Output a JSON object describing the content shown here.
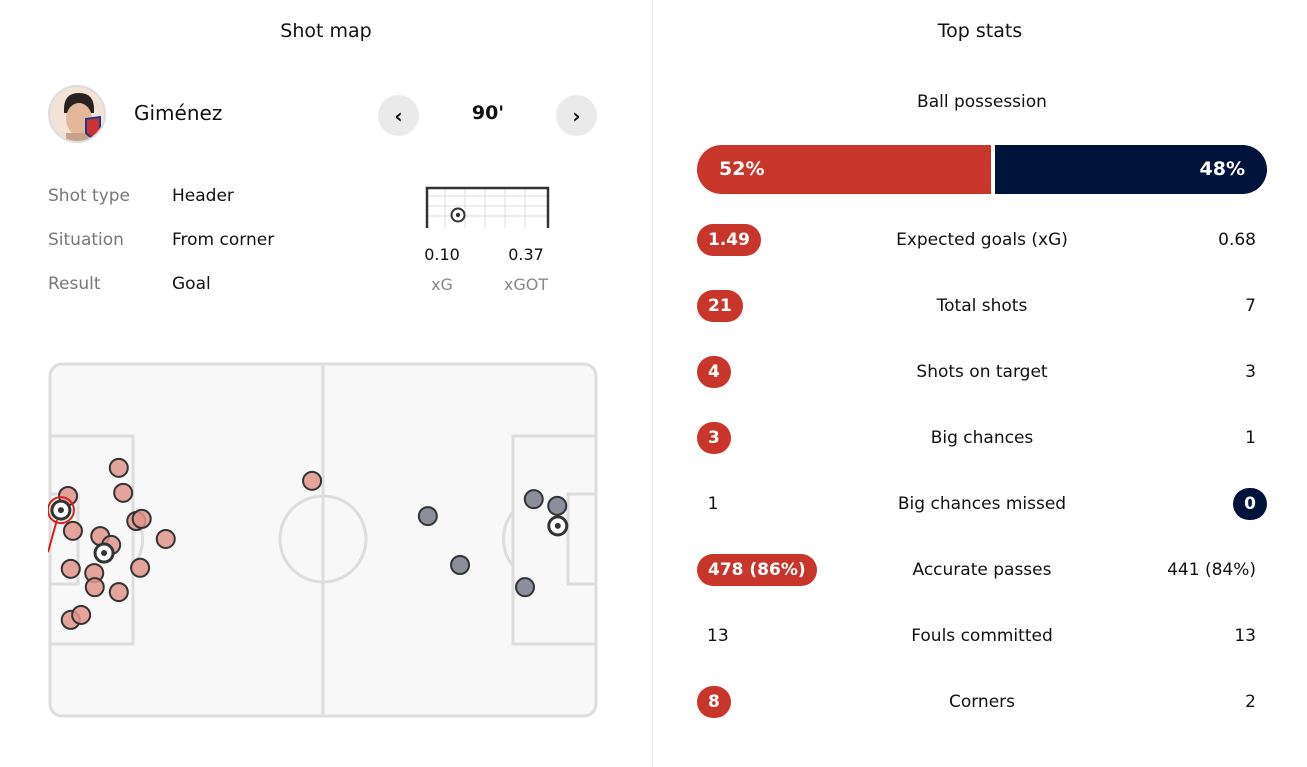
{
  "shot_map": {
    "title": "Shot map",
    "player": "Giménez",
    "minute": "90'",
    "prev_icon": "chevron-left",
    "next_icon": "chevron-right",
    "details": [
      {
        "label": "Shot type",
        "value": "Header"
      },
      {
        "label": "Situation",
        "value": "From corner"
      },
      {
        "label": "Result",
        "value": "Goal"
      }
    ],
    "xg": {
      "value": "0.10",
      "label": "xG"
    },
    "xgot": {
      "value": "0.37",
      "label": "xGOT"
    },
    "colors": {
      "home": "#e0958c",
      "away": "#8a8f9c",
      "selected": "#e0201b"
    },
    "shots_home": [
      [
        12.6,
        29.5
      ],
      [
        13.4,
        36.6
      ],
      [
        3.3,
        37.5
      ],
      [
        15.8,
        44.6
      ],
      [
        16.8,
        44.0
      ],
      [
        4.2,
        47.4
      ],
      [
        9.2,
        48.9
      ],
      [
        11.2,
        51.4
      ],
      [
        21.2,
        49.7
      ],
      [
        3.8,
        58.2
      ],
      [
        8.1,
        59.4
      ],
      [
        8.2,
        63.4
      ],
      [
        16.5,
        57.9
      ],
      [
        12.6,
        64.8
      ],
      [
        3.8,
        72.7
      ],
      [
        5.7,
        71.3
      ],
      [
        48.0,
        33.2
      ]
    ],
    "goals_home": [
      [
        2.0,
        41.5,
        "selected"
      ],
      [
        9.9,
        53.7,
        ""
      ]
    ],
    "shots_away": [
      [
        69.2,
        43.2
      ],
      [
        88.6,
        38.4
      ],
      [
        92.9,
        40.3
      ],
      [
        75.1,
        57.1
      ],
      [
        87.0,
        63.4
      ]
    ],
    "goals_away": [
      [
        93.0,
        46.0,
        ""
      ]
    ]
  },
  "top_stats": {
    "title": "Top stats",
    "possession": {
      "label": "Ball possession",
      "home": 52,
      "away": 48,
      "home_text": "52%",
      "away_text": "48%"
    },
    "colors": {
      "home": "#c8352a",
      "away": "#00133a"
    },
    "rows": [
      {
        "label": "Expected goals (xG)",
        "home": "1.49",
        "away": "0.68",
        "leader": "home"
      },
      {
        "label": "Total shots",
        "home": "21",
        "away": "7",
        "leader": "home"
      },
      {
        "label": "Shots on target",
        "home": "4",
        "away": "3",
        "leader": "home"
      },
      {
        "label": "Big chances",
        "home": "3",
        "away": "1",
        "leader": "home"
      },
      {
        "label": "Big chances missed",
        "home": "1",
        "away": "0",
        "leader": "away"
      },
      {
        "label": "Accurate passes",
        "home": "478 (86%)",
        "away": "441 (84%)",
        "leader": "home"
      },
      {
        "label": "Fouls committed",
        "home": "13",
        "away": "13",
        "leader": "none"
      },
      {
        "label": "Corners",
        "home": "8",
        "away": "2",
        "leader": "home"
      }
    ]
  }
}
